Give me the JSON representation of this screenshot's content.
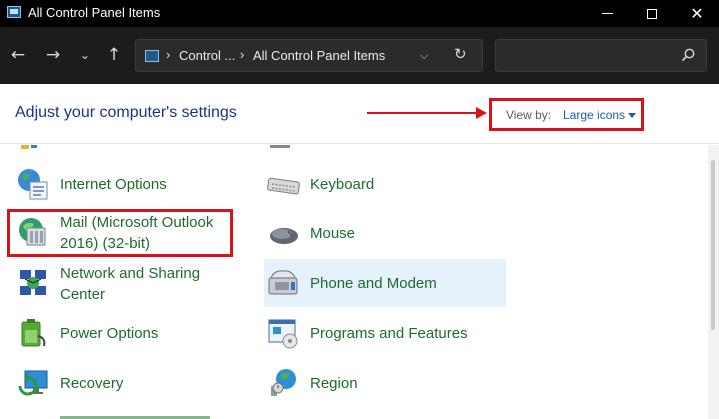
{
  "window": {
    "title": "All Control Panel Items",
    "controls": {
      "minimize": "minimize",
      "maximize": "maximize",
      "close": "✕"
    }
  },
  "nav": {
    "back": "←",
    "forward": "→",
    "recent": "⌄",
    "up": "↑"
  },
  "address": {
    "separator": "›",
    "crumbs": [
      "Control ...",
      "All Control Panel Items"
    ],
    "dropdown": "⌵",
    "refresh": "↻"
  },
  "search": {
    "value": "",
    "placeholder": ""
  },
  "header": {
    "heading": "Adjust your computer's settings",
    "view_by_label": "View by:",
    "view_by_value": "Large icons"
  },
  "annotation_color": "#d6141c",
  "items": {
    "left": [
      {
        "label": "Internet Options",
        "icon": "internet-options-icon"
      },
      {
        "label": "Mail (Microsoft Outlook 2016) (32-bit)",
        "icon": "mail-icon"
      },
      {
        "label": "Network and Sharing Center",
        "icon": "network-icon"
      },
      {
        "label": "Power Options",
        "icon": "power-icon"
      },
      {
        "label": "Recovery",
        "icon": "recovery-icon"
      }
    ],
    "right": [
      {
        "label": "Keyboard",
        "icon": "keyboard-icon"
      },
      {
        "label": "Mouse",
        "icon": "mouse-icon"
      },
      {
        "label": "Phone and Modem",
        "icon": "phone-icon"
      },
      {
        "label": "Programs and Features",
        "icon": "programs-icon"
      },
      {
        "label": "Region",
        "icon": "region-icon"
      }
    ]
  }
}
